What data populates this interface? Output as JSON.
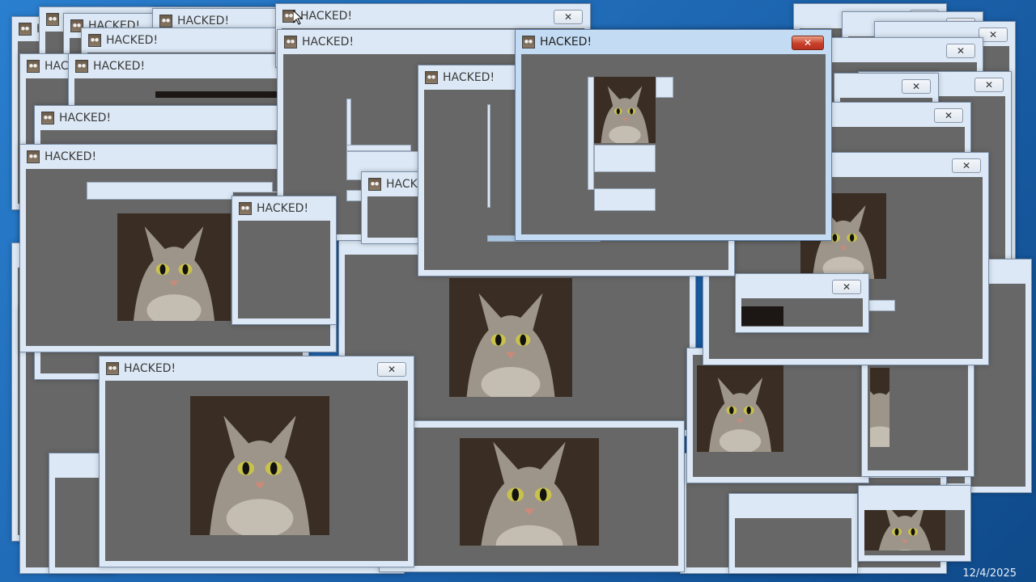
{
  "window_title": "HACKED!",
  "close_glyph": "✕",
  "icons": {
    "window": "cat-icon",
    "close": "close-icon",
    "image": "cat-photo"
  },
  "taskbar": {
    "date": "12/4/2025"
  },
  "colors": {
    "client_bg": "#676767",
    "frame_bg": "#dce8f5",
    "active_close": "#c8402a",
    "desktop": "#1a5fa8"
  }
}
